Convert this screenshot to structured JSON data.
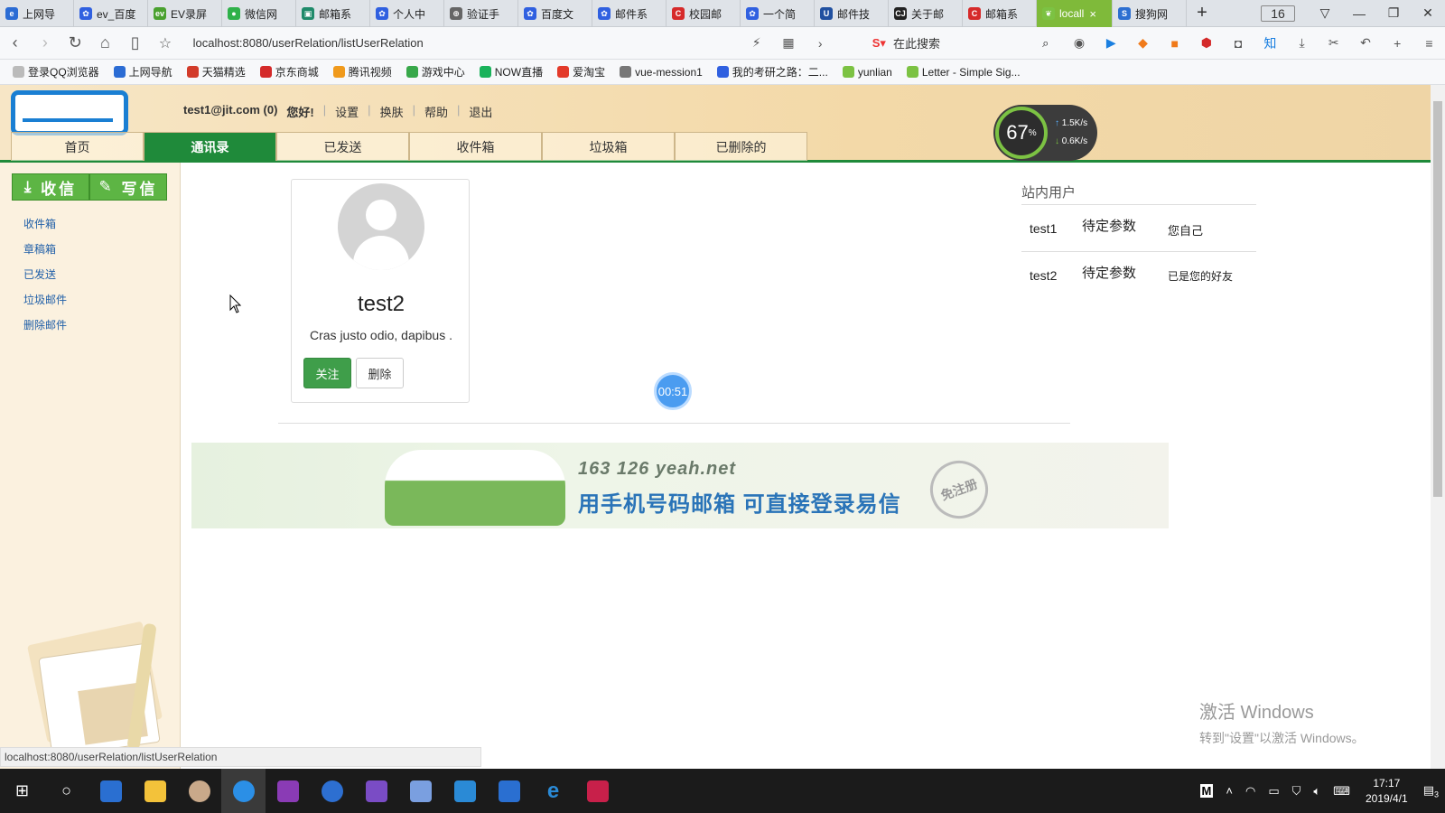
{
  "browser": {
    "tabs": [
      {
        "label": "上网导",
        "color": "#2b6cd4",
        "glyph": "e"
      },
      {
        "label": "ev_百度",
        "color": "#3060e0",
        "glyph": "✿"
      },
      {
        "label": "EV录屏",
        "color": "#4aa12f",
        "glyph": "ev"
      },
      {
        "label": "微信网",
        "color": "#2fb14a",
        "glyph": "●"
      },
      {
        "label": "邮箱系",
        "color": "#1f8a6a",
        "glyph": "▣"
      },
      {
        "label": "个人中",
        "color": "#3060e0",
        "glyph": "✿"
      },
      {
        "label": "验证手",
        "color": "#666",
        "glyph": "⊕"
      },
      {
        "label": "百度文",
        "color": "#3060e0",
        "glyph": "✿"
      },
      {
        "label": "邮件系",
        "color": "#3060e0",
        "glyph": "✿"
      },
      {
        "label": "校园邮",
        "color": "#d62a2a",
        "glyph": "C"
      },
      {
        "label": "一个简",
        "color": "#3060e0",
        "glyph": "✿"
      },
      {
        "label": "邮件技",
        "color": "#2050a0",
        "glyph": "U"
      },
      {
        "label": "关于邮",
        "color": "#222",
        "glyph": "CJ"
      },
      {
        "label": "邮箱系",
        "color": "#d62a2a",
        "glyph": "C"
      },
      {
        "label": "locall",
        "color": "#7cc243",
        "glyph": "❦"
      },
      {
        "label": "搜狗网",
        "color": "#2d6fd1",
        "glyph": "S"
      }
    ],
    "active_tab_index": 14,
    "tab_count": "16",
    "url": "localhost:8080/userRelation/listUserRelation",
    "search_placeholder": "在此搜索",
    "bookmarks": [
      {
        "label": "登录QQ浏览器",
        "color": "#bbb"
      },
      {
        "label": "上网导航",
        "color": "#2b6cd4"
      },
      {
        "label": "天猫精选",
        "color": "#d23b2a"
      },
      {
        "label": "京东商城",
        "color": "#d42a2a"
      },
      {
        "label": "腾讯视频",
        "color": "#f09a1c"
      },
      {
        "label": "游戏中心",
        "color": "#38a84a"
      },
      {
        "label": "NOW直播",
        "color": "#19b25a"
      },
      {
        "label": "爱淘宝",
        "color": "#e33a2a"
      },
      {
        "label": "vue-mession1",
        "color": "#777"
      },
      {
        "label": "我的考研之路：二...",
        "color": "#3060e0"
      },
      {
        "label": "yunlian",
        "color": "#7cc243"
      },
      {
        "label": "Letter - Simple Sig...",
        "color": "#7cc243"
      }
    ],
    "status_url": "localhost:8080/userRelation/listUserRelation"
  },
  "header": {
    "user": "test1@jit.com (0)",
    "greeting": "您好!",
    "links": [
      "设置",
      "换肤",
      "帮助",
      "退出"
    ],
    "tabs": [
      "首页",
      "通讯录",
      "已发送",
      "收件箱",
      "垃圾箱",
      "已删除的"
    ],
    "active_tab_index": 1,
    "speed": {
      "percent": "67",
      "unit": "%",
      "up": "1.5K/s",
      "down": "0.6K/s"
    }
  },
  "sidebar": {
    "receive_label": "收信",
    "write_label": "写信",
    "links": [
      "收件箱",
      "章稿箱",
      "已发送",
      "垃圾邮件",
      "删除邮件"
    ]
  },
  "card": {
    "name": "test2",
    "desc": "Cras justo odio, dapibus .",
    "follow_label": "关注",
    "delete_label": "删除"
  },
  "timer": "00:51",
  "banner": {
    "brands": "163  126  yeah.net",
    "slogan": "用手机号码邮箱  可直接登录易信",
    "badge": "免注册"
  },
  "users_panel": {
    "title": "站内用户",
    "rows": [
      {
        "name": "test1",
        "param": "待定参数",
        "status": "您自己"
      },
      {
        "name": "test2",
        "param": "待定参数",
        "status": "已是您的好友"
      }
    ]
  },
  "watermark": {
    "line1": "激活 Windows",
    "line2": "转到\"设置\"以激活 Windows。"
  },
  "taskbar": {
    "time": "17:17",
    "date": "2019/4/1",
    "notify_count": "3",
    "ime": "M"
  }
}
